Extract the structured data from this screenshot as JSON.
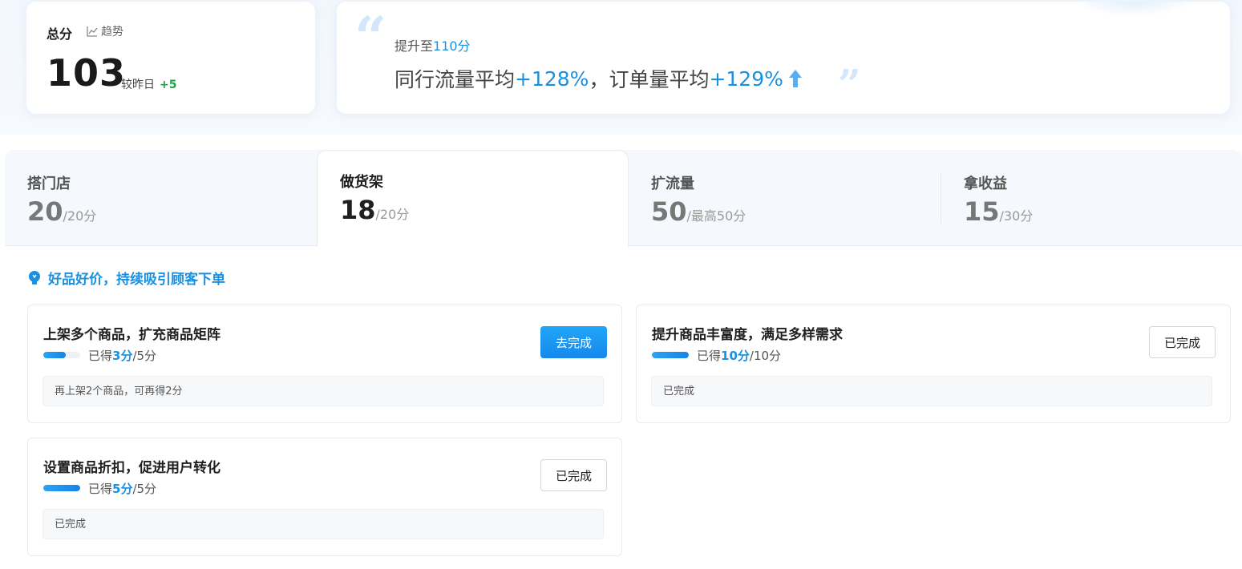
{
  "score": {
    "title": "总分",
    "trend_label": "趋势",
    "value": "103",
    "compare_label": "较昨日",
    "compare_delta": "+5"
  },
  "promo": {
    "sub_prefix": "提升至",
    "sub_target": "110分",
    "line_prefix": "同行流量平均",
    "traffic_gain": "+128%",
    "line_mid": "，订单量平均",
    "order_gain": "+129%"
  },
  "tabs": [
    {
      "name": "搭门店",
      "score": "20",
      "of": "/20分"
    },
    {
      "name": "做货架",
      "score": "18",
      "of": "/20分"
    },
    {
      "name": "扩流量",
      "score": "50",
      "of": "/最高50分"
    },
    {
      "name": "拿收益",
      "score": "15",
      "of": "/30分"
    }
  ],
  "active_tab": 1,
  "tip": "好品好价，持续吸引顾客下单",
  "tasks": [
    {
      "title": "上架多个商品，扩充商品矩阵",
      "got_prefix": "已得",
      "got": "3分",
      "total": "/5分",
      "progress": 0.6,
      "note": "再上架2个商品，可再得2分",
      "button": "去完成",
      "button_style": "primary"
    },
    {
      "title": "提升商品丰富度，满足多样需求",
      "got_prefix": "已得",
      "got": "10分",
      "total": "/10分",
      "progress": 1.0,
      "note": "已完成",
      "button": "已完成",
      "button_style": "done"
    },
    {
      "title": "设置商品折扣，促进用户转化",
      "got_prefix": "已得",
      "got": "5分",
      "total": "/5分",
      "progress": 1.0,
      "note": "已完成",
      "button": "已完成",
      "button_style": "done"
    }
  ],
  "colors": {
    "accent": "#1a90e0",
    "positive": "#17a349"
  },
  "icons": {
    "trend": "line-chart-icon",
    "tip": "lightbulb-icon",
    "arrow": "up-arrow-icon"
  }
}
